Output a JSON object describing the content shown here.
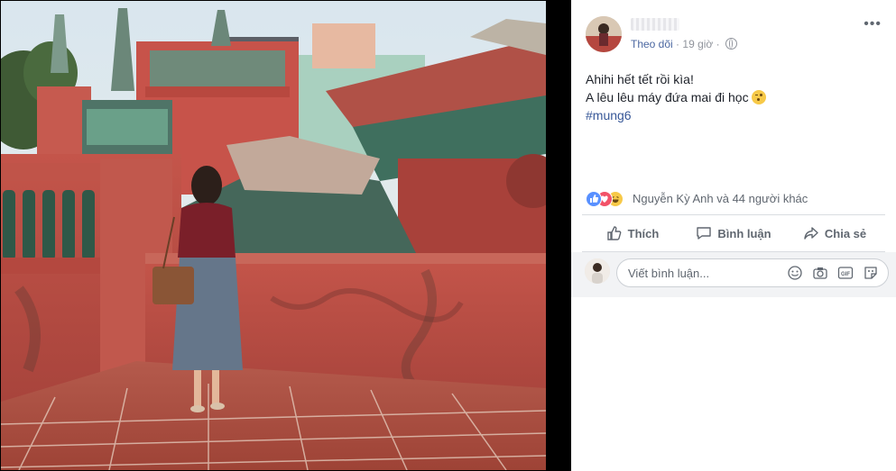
{
  "post": {
    "follow_label": "Theo dõi",
    "time": "19 giờ",
    "text_line1": "Ahihi hết tết rồi kìa!",
    "text_line2": "A lêu lêu máy đứa mai đi học",
    "hashtag": "#mung6"
  },
  "reactions": {
    "summary": "Nguyễn Kỳ Anh và 44 người khác",
    "types": [
      "like-icon",
      "love-icon",
      "haha-icon"
    ]
  },
  "actions": {
    "like": "Thích",
    "comment": "Bình luận",
    "share": "Chia sẻ"
  },
  "comment_box": {
    "placeholder": "Viết bình luận...",
    "icons": [
      "emoji-icon",
      "camera-icon",
      "gif-icon",
      "sticker-icon"
    ]
  },
  "colors": {
    "link": "#385898",
    "like_blue": "#5890ff",
    "love_red": "#f25268",
    "text_gray": "#606770"
  }
}
